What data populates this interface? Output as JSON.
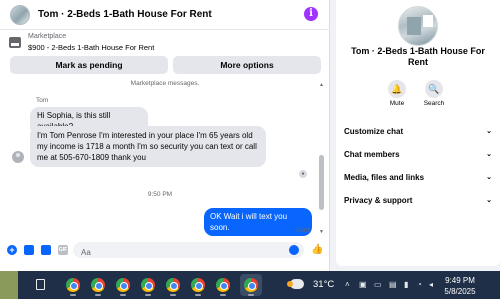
{
  "chat": {
    "header_title": "Tom · 2-Beds 1-Bath House For Rent",
    "info_icon": "i",
    "marketplace_label": "Marketplace",
    "listing": "$900 - 2-Beds 1-Bath House For Rent",
    "btn_pending": "Mark as pending",
    "btn_more": "More options",
    "system_message": "Marketplace messages.",
    "sender_name": "Tom",
    "msg1": "Hi Sophia, is this still available?",
    "msg2": "I'm Tom Penrose I'm interested in your place I'm 65 years old my income is 1718 a month I'm so security you can text or call me at 505-670-1809 thank you",
    "time_separator": "9:50 PM",
    "msg_out": "OK Wait i will text you soon.",
    "sent_status": "Sent",
    "composer_placeholder": "Aa",
    "gif_label": "GIF"
  },
  "details": {
    "title": "Tom · 2-Beds 1-Bath House For Rent",
    "mute_label": "Mute",
    "search_label": "Search",
    "sections": [
      "Customize chat",
      "Chat members",
      "Media, files and links",
      "Privacy & support"
    ]
  },
  "taskbar": {
    "temperature": "31°C",
    "time": "9:49 PM",
    "date": "5/8/2025"
  },
  "colors": {
    "accent": "#0866ff",
    "info": "#a033ff",
    "taskbar": "#1f2f47"
  },
  "icons": [
    "marketplace-icon",
    "info-icon",
    "plus-icon",
    "photo-icon",
    "sticker-icon",
    "gif-icon",
    "emoji-icon",
    "like-icon",
    "bell-icon",
    "search-icon",
    "chevron-down-icon",
    "chrome-icon",
    "weather-icon"
  ]
}
